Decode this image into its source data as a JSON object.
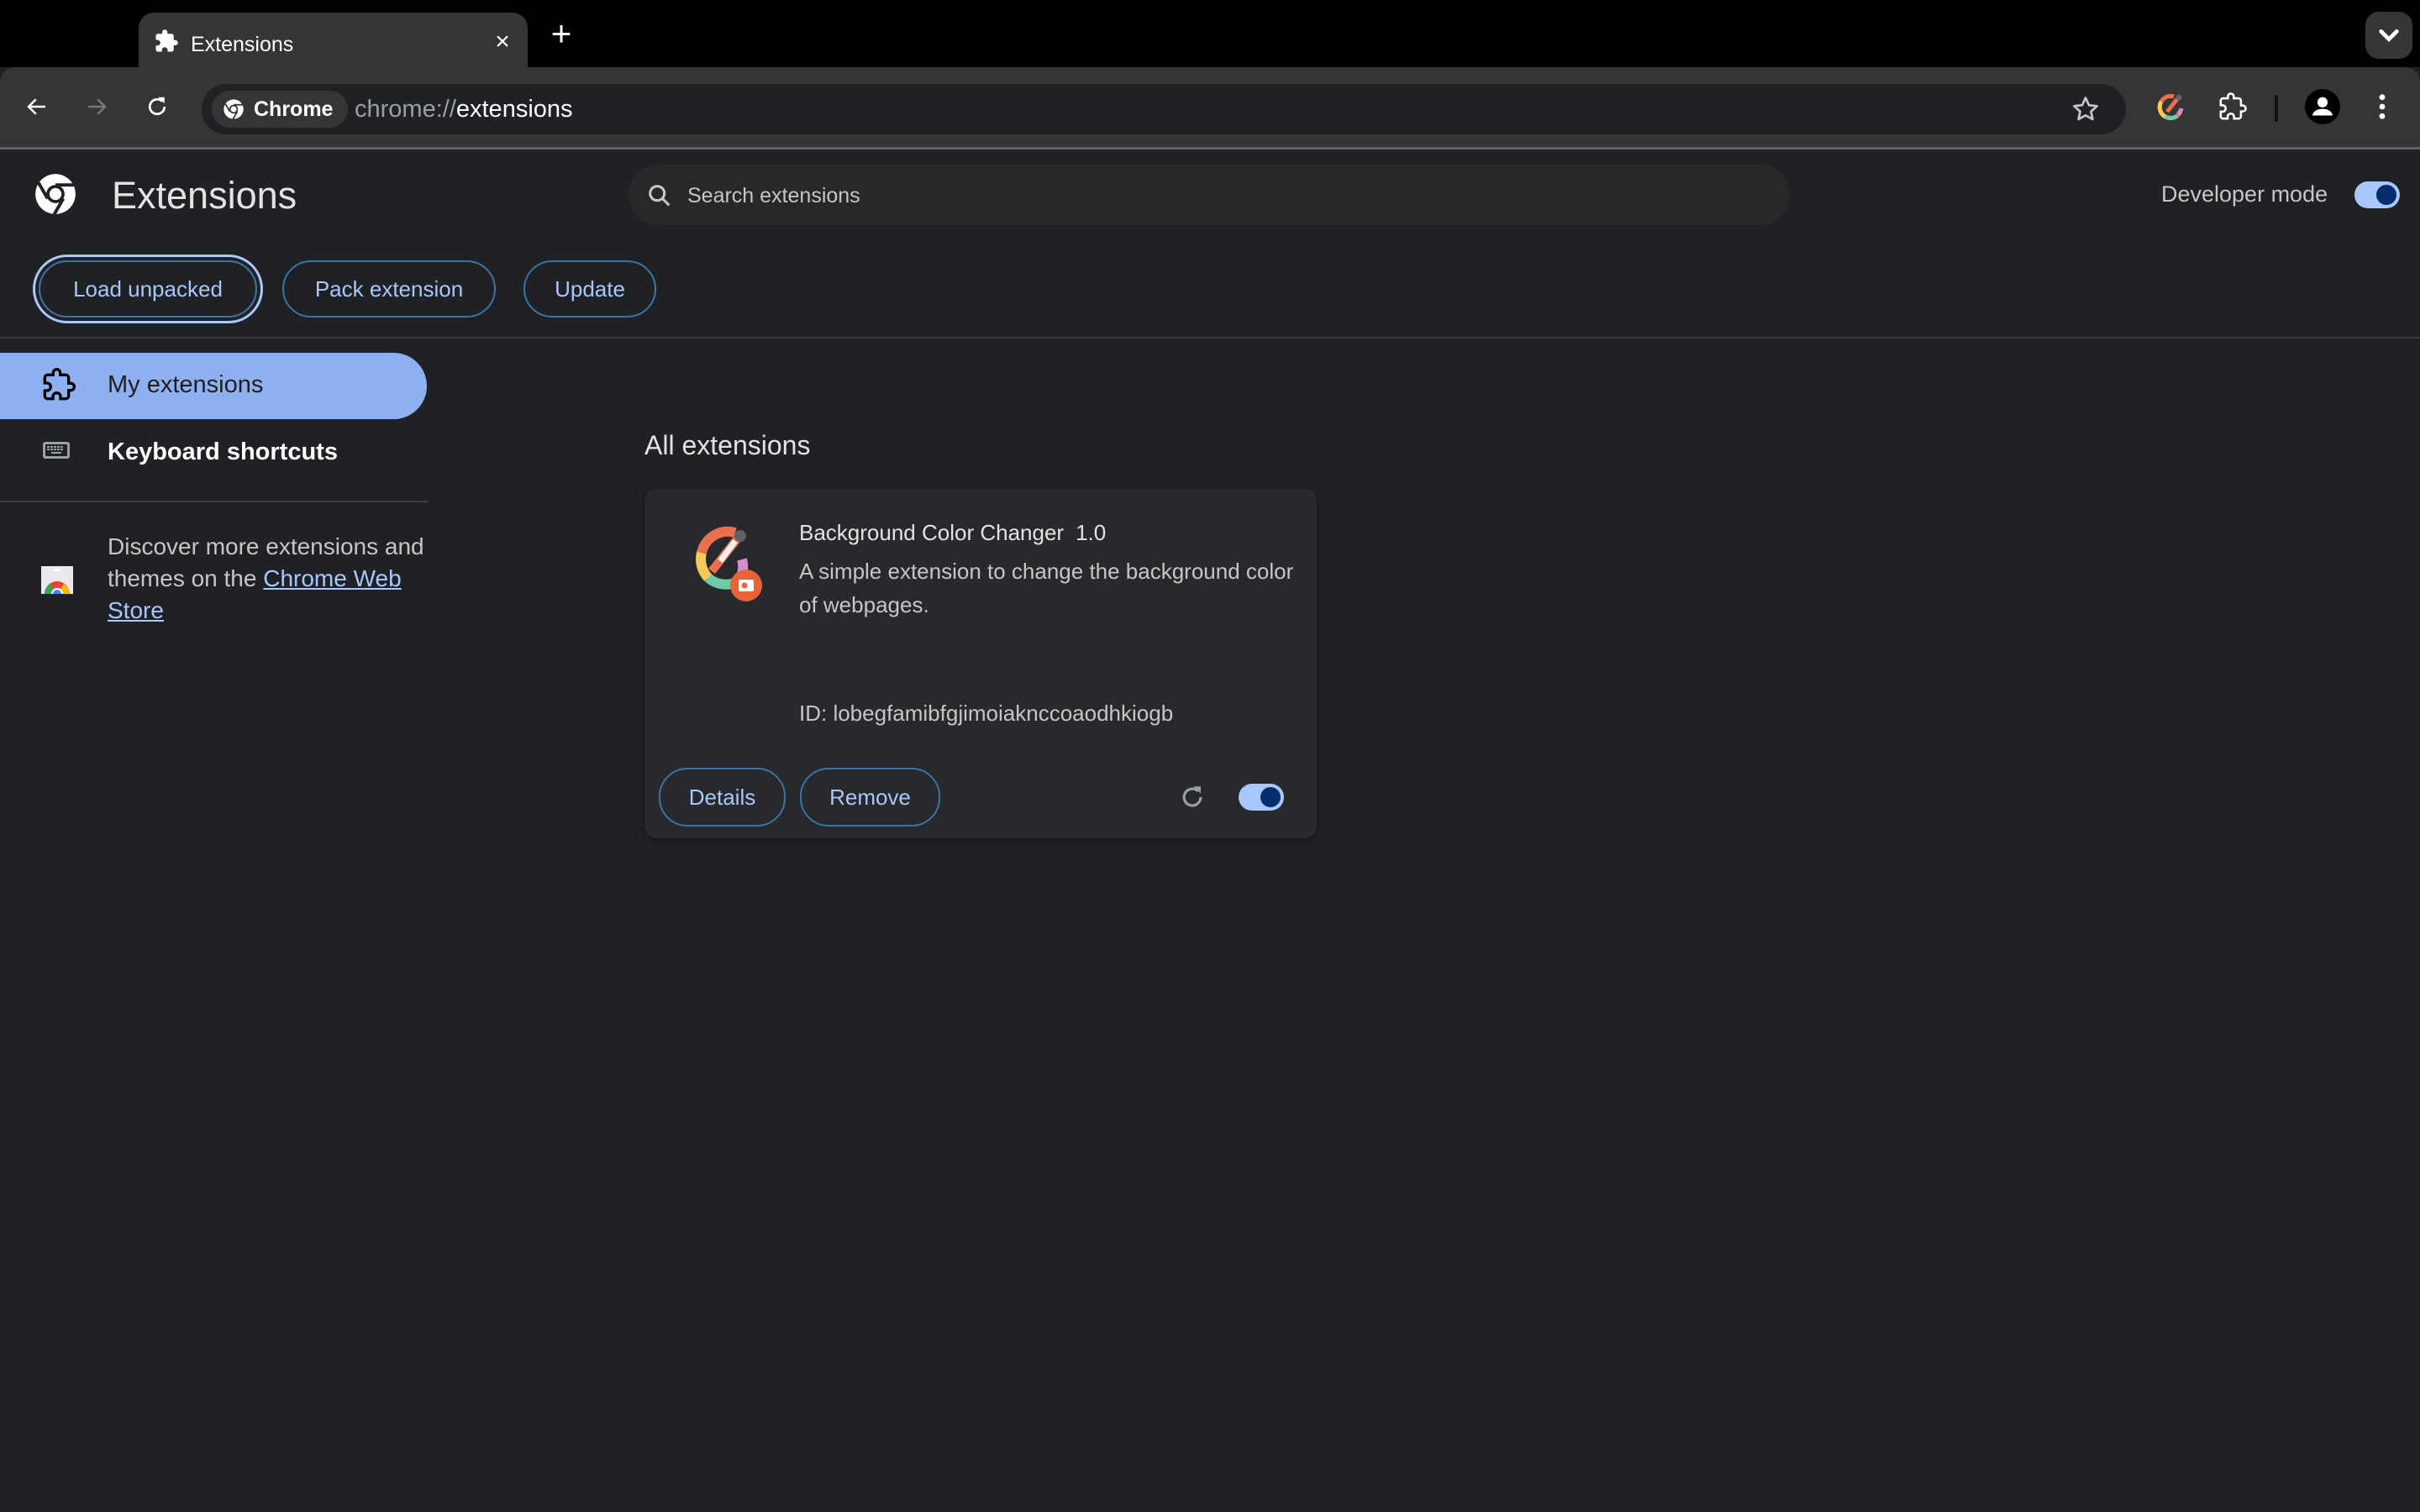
{
  "browser": {
    "tab": {
      "title": "Extensions",
      "icon": "puzzle-icon",
      "close_icon": "close-icon"
    },
    "new_tab_icon": "plus-icon",
    "tab_search_icon": "chevron-down-icon",
    "toolbar": {
      "back_icon": "back-arrow-icon",
      "forward_icon": "forward-arrow-icon",
      "reload_icon": "reload-icon",
      "chip_label": "Chrome",
      "url_scheme": "chrome://",
      "url_host": "extensions",
      "bookmark_icon": "star-icon",
      "extension_action_icon": "color-picker-icon",
      "extensions_menu_icon": "puzzle-icon",
      "profile_icon": "avatar-icon",
      "menu_icon": "kebab-menu-icon"
    }
  },
  "header": {
    "title": "Extensions",
    "search_placeholder": "Search extensions",
    "search_value": "",
    "developer_mode_label": "Developer mode",
    "developer_mode_on": true
  },
  "actions": {
    "load_unpacked": "Load unpacked",
    "pack_extension": "Pack extension",
    "update": "Update"
  },
  "sidebar": {
    "items": [
      {
        "label": "My extensions",
        "icon": "puzzle-icon",
        "selected": true
      },
      {
        "label": "Keyboard shortcuts",
        "icon": "keyboard-icon",
        "selected": false
      }
    ],
    "discover_text": "Discover more extensions and themes on the ",
    "store_link": "Chrome Web Store"
  },
  "main": {
    "section_title": "All extensions",
    "extensions": [
      {
        "name": "Background Color Changer",
        "version": "1.0",
        "description": "A simple extension to change the background color of webpages.",
        "id_label": "ID: lobegfamibfgjimoiaknccoaodhkiogb",
        "details_label": "Details",
        "remove_label": "Remove",
        "enabled": true
      }
    ]
  },
  "colors": {
    "accent": "#a8c7fa",
    "selected_nav": "#8fb0f0",
    "page_bg": "#202124",
    "card_bg": "#28292c",
    "toolbar_bg": "#353535"
  }
}
